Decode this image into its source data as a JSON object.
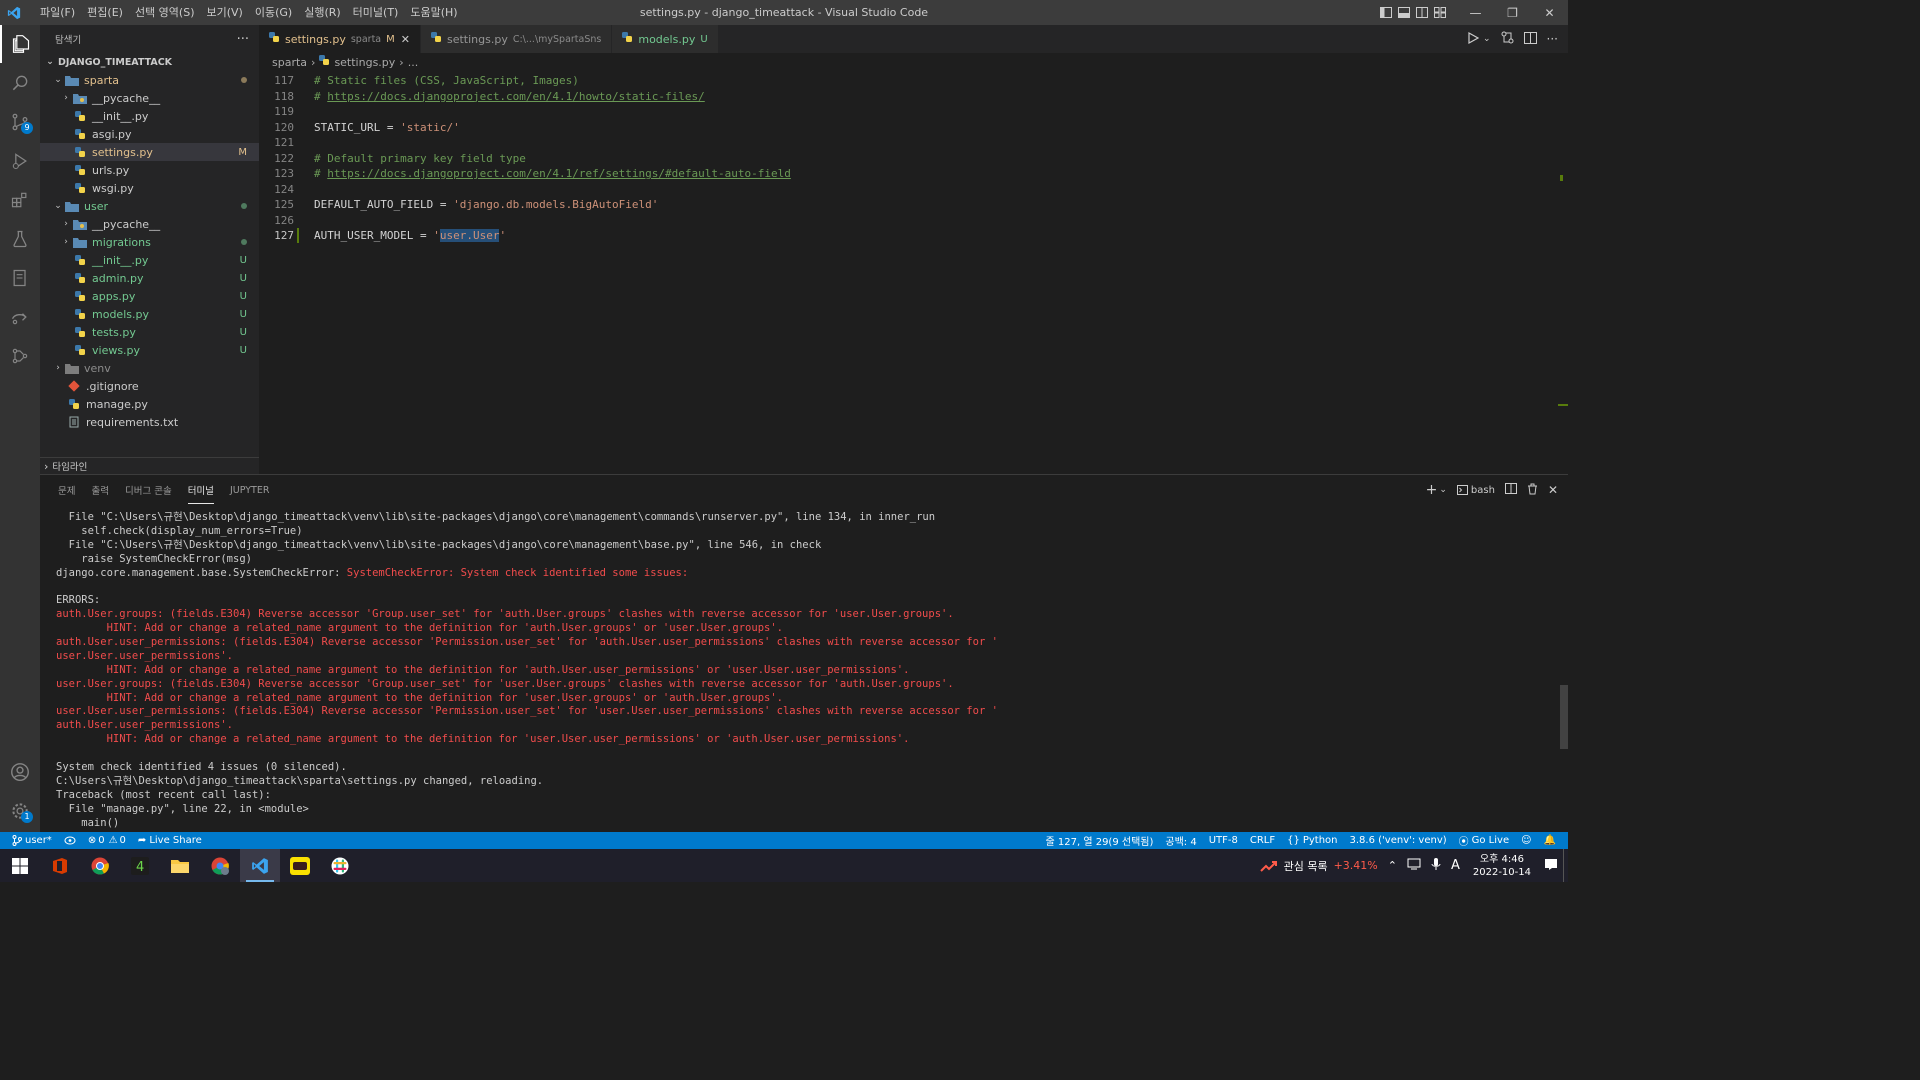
{
  "titlebar": {
    "menu": [
      "파일(F)",
      "편집(E)",
      "선택 영역(S)",
      "보기(V)",
      "이동(G)",
      "실행(R)",
      "터미널(T)",
      "도움말(H)"
    ],
    "title": "settings.py - django_timeattack - Visual Studio Code"
  },
  "activity": {
    "source_control_badge": "9",
    "settings_badge": "1"
  },
  "sidebar": {
    "header": "탐색기",
    "root": "DJANGO_TIMEATTACK",
    "items": [
      {
        "label": "sparta",
        "status": ""
      },
      {
        "label": "__pycache__",
        "status": ""
      },
      {
        "label": "__init__.py",
        "status": ""
      },
      {
        "label": "asgi.py",
        "status": ""
      },
      {
        "label": "settings.py",
        "status": "M"
      },
      {
        "label": "urls.py",
        "status": ""
      },
      {
        "label": "wsgi.py",
        "status": ""
      },
      {
        "label": "user",
        "status": ""
      },
      {
        "label": "__pycache__",
        "status": ""
      },
      {
        "label": "migrations",
        "status": ""
      },
      {
        "label": "__init__.py",
        "status": "U"
      },
      {
        "label": "admin.py",
        "status": "U"
      },
      {
        "label": "apps.py",
        "status": "U"
      },
      {
        "label": "models.py",
        "status": "U"
      },
      {
        "label": "tests.py",
        "status": "U"
      },
      {
        "label": "views.py",
        "status": "U"
      },
      {
        "label": "venv",
        "status": ""
      },
      {
        "label": ".gitignore",
        "status": ""
      },
      {
        "label": "manage.py",
        "status": ""
      },
      {
        "label": "requirements.txt",
        "status": ""
      }
    ],
    "timeline": "타임라인"
  },
  "tabs": [
    {
      "label": "settings.py",
      "desc": "sparta",
      "mark": "M"
    },
    {
      "label": "settings.py",
      "desc": "C:\\...\\mySpartaSns",
      "mark": ""
    },
    {
      "label": "models.py",
      "desc": "",
      "mark": "U"
    }
  ],
  "breadcrumb": {
    "folder": "sparta",
    "file": "settings.py",
    "rest": "..."
  },
  "code": {
    "lines": [
      {
        "n": "117",
        "a": "# Static files (CSS, JavaScript, Images)"
      },
      {
        "n": "118",
        "a": "# ",
        "link": "https://docs.djangoproject.com/en/4.1/howto/static-files/"
      },
      {
        "n": "119",
        "a": ""
      },
      {
        "n": "120",
        "a": "STATIC_URL = ",
        "s": "'static/'"
      },
      {
        "n": "121",
        "a": ""
      },
      {
        "n": "122",
        "a": "# Default primary key field type"
      },
      {
        "n": "123",
        "a": "# ",
        "link": "https://docs.djangoproject.com/en/4.1/ref/settings/#default-auto-field"
      },
      {
        "n": "124",
        "a": ""
      },
      {
        "n": "125",
        "a": "DEFAULT_AUTO_FIELD = ",
        "s": "'django.db.models.BigAutoField'"
      },
      {
        "n": "126",
        "a": ""
      },
      {
        "n": "127",
        "a": "AUTH_USER_MODEL = ",
        "q1": "'",
        "selected": "user.User",
        "q2": "'"
      }
    ]
  },
  "panel": {
    "tabs": [
      "문제",
      "출력",
      "디버그 콘솔",
      "터미널",
      "JUPYTER"
    ],
    "active_tab": "터미널",
    "shell": "bash",
    "terminal": [
      {
        "t": "  File \"C:\\Users\\규현\\Desktop\\django_timeattack\\venv\\lib\\site-packages\\django\\core\\management\\commands\\runserver.py\", line 134, in inner_run",
        "e": false
      },
      {
        "t": "    self.check(display_num_errors=True)",
        "e": false
      },
      {
        "t": "  File \"C:\\Users\\규현\\Desktop\\django_timeattack\\venv\\lib\\site-packages\\django\\core\\management\\base.py\", line 546, in check",
        "e": false
      },
      {
        "t": "    raise SystemCheckError(msg)",
        "e": false
      },
      {
        "t": "django.core.management.base.SystemCheckError: ",
        "e": false,
        "tail": "SystemCheckError: System check identified some issues:"
      },
      {
        "t": "",
        "e": false
      },
      {
        "t": "ERRORS:",
        "e": false
      },
      {
        "t": "auth.User.groups: (fields.E304) Reverse accessor 'Group.user_set' for 'auth.User.groups' clashes with reverse accessor for 'user.User.groups'.",
        "e": true
      },
      {
        "t": "        HINT: Add or change a related_name argument to the definition for 'auth.User.groups' or 'user.User.groups'.",
        "e": true
      },
      {
        "t": "auth.User.user_permissions: (fields.E304) Reverse accessor 'Permission.user_set' for 'auth.User.user_permissions' clashes with reverse accessor for '",
        "e": true
      },
      {
        "t": "user.User.user_permissions'.",
        "e": true
      },
      {
        "t": "        HINT: Add or change a related_name argument to the definition for 'auth.User.user_permissions' or 'user.User.user_permissions'.",
        "e": true
      },
      {
        "t": "user.User.groups: (fields.E304) Reverse accessor 'Group.user_set' for 'user.User.groups' clashes with reverse accessor for 'auth.User.groups'.",
        "e": true
      },
      {
        "t": "        HINT: Add or change a related_name argument to the definition for 'user.User.groups' or 'auth.User.groups'.",
        "e": true
      },
      {
        "t": "user.User.user_permissions: (fields.E304) Reverse accessor 'Permission.user_set' for 'user.User.user_permissions' clashes with reverse accessor for '",
        "e": true
      },
      {
        "t": "auth.User.user_permissions'.",
        "e": true
      },
      {
        "t": "        HINT: Add or change a related_name argument to the definition for 'user.User.user_permissions' or 'auth.User.user_permissions'.",
        "e": true
      },
      {
        "t": "",
        "e": false
      },
      {
        "t": "System check identified 4 issues (0 silenced).",
        "e": false
      },
      {
        "t": "C:\\Users\\규현\\Desktop\\django_timeattack\\sparta\\settings.py changed, reloading.",
        "e": false
      },
      {
        "t": "Traceback (most recent call last):",
        "e": false
      },
      {
        "t": "  File \"manage.py\", line 22, in <module>",
        "e": false
      },
      {
        "t": "    main()",
        "e": false
      }
    ]
  },
  "statusbar": {
    "branch": "user*",
    "errors": "0",
    "warnings": "0",
    "live_share": "Live Share",
    "position": "줄 127, 열 29(9 선택됨)",
    "spaces": "공백: 4",
    "encoding": "UTF-8",
    "eol": "CRLF",
    "language": "Python",
    "interpreter": "3.8.6 ('venv': venv)",
    "go_live": "Go Live"
  },
  "taskbar": {
    "stock_label": "관심 목록",
    "stock_change": "+3.41%",
    "ime": "A",
    "time": "오후 4:46",
    "date": "2022-10-14"
  },
  "colors": {
    "accent": "#007acc",
    "error": "#f14c4c",
    "git_untracked": "#73c991",
    "git_modified": "#e2c08d"
  }
}
